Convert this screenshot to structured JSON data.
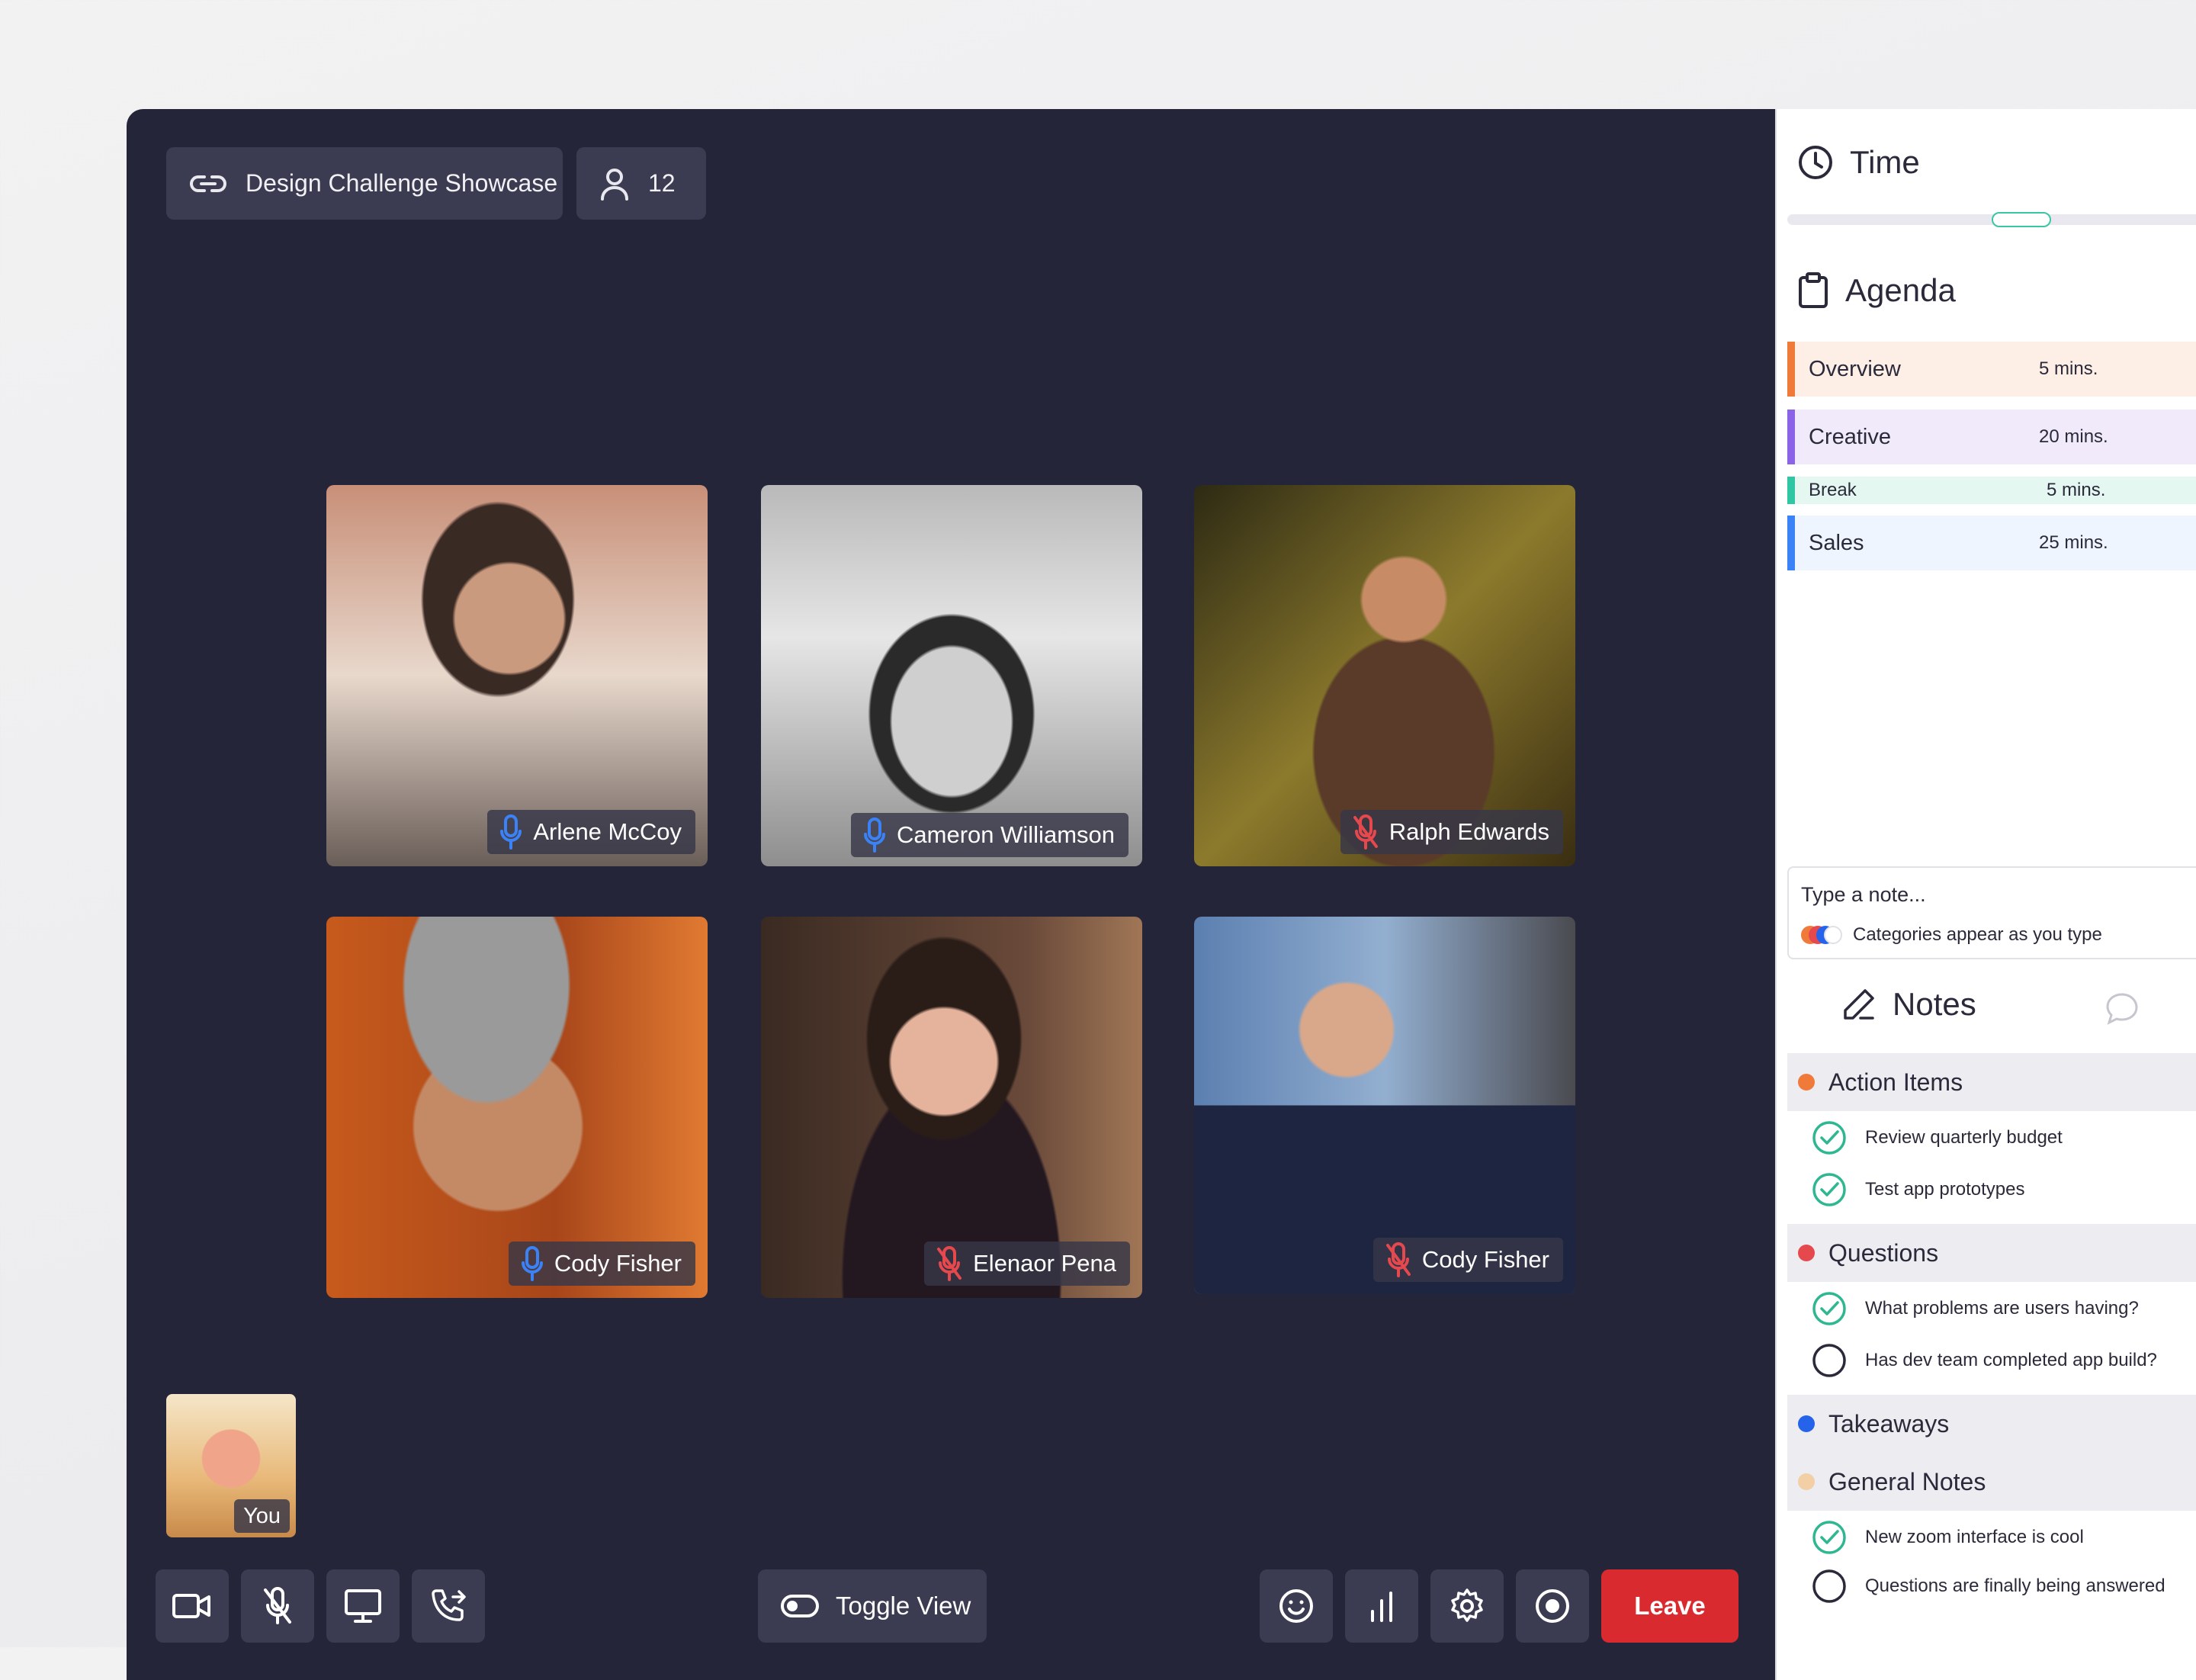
{
  "meeting": {
    "title": "Design Challenge Showcase",
    "participant_count": "12"
  },
  "participants": [
    {
      "name": "Arlene McCoy",
      "mic": "on"
    },
    {
      "name": "Cameron Williamson",
      "mic": "on"
    },
    {
      "name": "Ralph Edwards",
      "mic": "muted"
    },
    {
      "name": "Cody Fisher",
      "mic": "on"
    },
    {
      "name": "Elenaor Pena",
      "mic": "muted"
    },
    {
      "name": "Cody Fisher",
      "mic": "muted"
    }
  ],
  "self_view": {
    "label": "You"
  },
  "controls": {
    "toggle_view": "Toggle View",
    "leave": "Leave"
  },
  "panel": {
    "time_title": "Time",
    "time_progress": 0.5,
    "agenda_title": "Agenda",
    "agenda": [
      {
        "label": "Overview",
        "duration": "5 mins.",
        "color": "#f07a3a",
        "bg": "#fdeee6"
      },
      {
        "label": "Creative",
        "duration": "20 mins.",
        "color": "#8a63e6",
        "bg": "#f1eafb"
      },
      {
        "label": "Break",
        "duration": "5 mins.",
        "color": "#2fc7a3",
        "bg": "#e4f7f1"
      },
      {
        "label": "Sales",
        "duration": "25 mins.",
        "color": "#3b82f6",
        "bg": "#eef5fe"
      }
    ],
    "note_placeholder": "Type a note...",
    "note_hint": "Categories appear as you type",
    "notes_title": "Notes",
    "categories": [
      {
        "name": "Action Items",
        "color": "#f07a3a",
        "items": [
          {
            "text": "Review quarterly budget",
            "done": true
          },
          {
            "text": "Test app prototypes",
            "done": true
          }
        ]
      },
      {
        "name": "Questions",
        "color": "#e5484d",
        "items": [
          {
            "text": "What problems are users having?",
            "done": true
          },
          {
            "text": "Has dev team completed app build?",
            "done": false
          }
        ]
      },
      {
        "name": "Takeaways",
        "color": "#2563eb",
        "items": []
      },
      {
        "name": "General Notes",
        "color": "#f3cfa6",
        "items": [
          {
            "text": "New zoom interface is cool",
            "done": true
          },
          {
            "text": "Questions are finally being answered",
            "done": false
          }
        ]
      }
    ]
  }
}
